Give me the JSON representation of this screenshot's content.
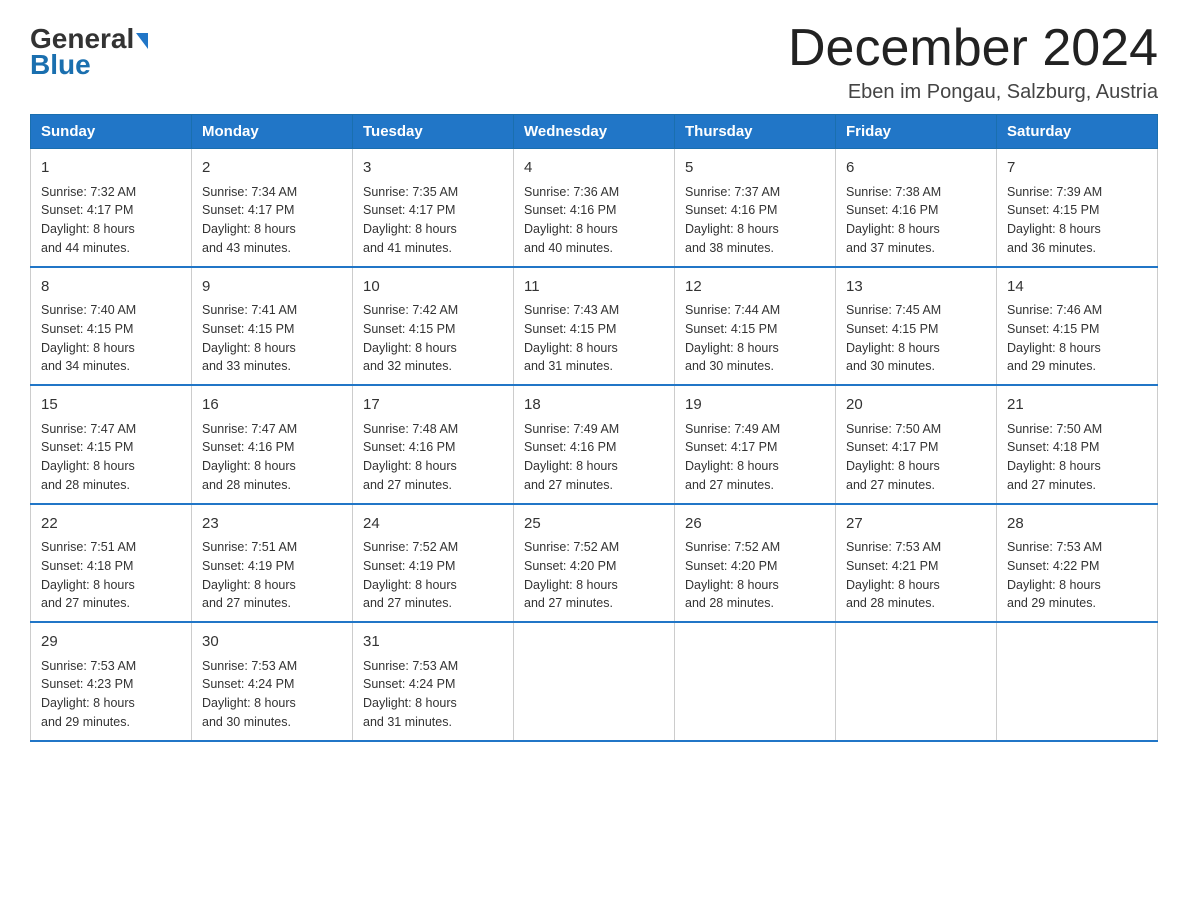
{
  "header": {
    "logo_general": "General",
    "logo_blue": "Blue",
    "month_title": "December 2024",
    "location": "Eben im Pongau, Salzburg, Austria"
  },
  "days_of_week": [
    "Sunday",
    "Monday",
    "Tuesday",
    "Wednesday",
    "Thursday",
    "Friday",
    "Saturday"
  ],
  "weeks": [
    [
      {
        "day": "1",
        "sunrise": "7:32 AM",
        "sunset": "4:17 PM",
        "daylight": "8 hours and 44 minutes."
      },
      {
        "day": "2",
        "sunrise": "7:34 AM",
        "sunset": "4:17 PM",
        "daylight": "8 hours and 43 minutes."
      },
      {
        "day": "3",
        "sunrise": "7:35 AM",
        "sunset": "4:17 PM",
        "daylight": "8 hours and 41 minutes."
      },
      {
        "day": "4",
        "sunrise": "7:36 AM",
        "sunset": "4:16 PM",
        "daylight": "8 hours and 40 minutes."
      },
      {
        "day": "5",
        "sunrise": "7:37 AM",
        "sunset": "4:16 PM",
        "daylight": "8 hours and 38 minutes."
      },
      {
        "day": "6",
        "sunrise": "7:38 AM",
        "sunset": "4:16 PM",
        "daylight": "8 hours and 37 minutes."
      },
      {
        "day": "7",
        "sunrise": "7:39 AM",
        "sunset": "4:15 PM",
        "daylight": "8 hours and 36 minutes."
      }
    ],
    [
      {
        "day": "8",
        "sunrise": "7:40 AM",
        "sunset": "4:15 PM",
        "daylight": "8 hours and 34 minutes."
      },
      {
        "day": "9",
        "sunrise": "7:41 AM",
        "sunset": "4:15 PM",
        "daylight": "8 hours and 33 minutes."
      },
      {
        "day": "10",
        "sunrise": "7:42 AM",
        "sunset": "4:15 PM",
        "daylight": "8 hours and 32 minutes."
      },
      {
        "day": "11",
        "sunrise": "7:43 AM",
        "sunset": "4:15 PM",
        "daylight": "8 hours and 31 minutes."
      },
      {
        "day": "12",
        "sunrise": "7:44 AM",
        "sunset": "4:15 PM",
        "daylight": "8 hours and 30 minutes."
      },
      {
        "day": "13",
        "sunrise": "7:45 AM",
        "sunset": "4:15 PM",
        "daylight": "8 hours and 30 minutes."
      },
      {
        "day": "14",
        "sunrise": "7:46 AM",
        "sunset": "4:15 PM",
        "daylight": "8 hours and 29 minutes."
      }
    ],
    [
      {
        "day": "15",
        "sunrise": "7:47 AM",
        "sunset": "4:15 PM",
        "daylight": "8 hours and 28 minutes."
      },
      {
        "day": "16",
        "sunrise": "7:47 AM",
        "sunset": "4:16 PM",
        "daylight": "8 hours and 28 minutes."
      },
      {
        "day": "17",
        "sunrise": "7:48 AM",
        "sunset": "4:16 PM",
        "daylight": "8 hours and 27 minutes."
      },
      {
        "day": "18",
        "sunrise": "7:49 AM",
        "sunset": "4:16 PM",
        "daylight": "8 hours and 27 minutes."
      },
      {
        "day": "19",
        "sunrise": "7:49 AM",
        "sunset": "4:17 PM",
        "daylight": "8 hours and 27 minutes."
      },
      {
        "day": "20",
        "sunrise": "7:50 AM",
        "sunset": "4:17 PM",
        "daylight": "8 hours and 27 minutes."
      },
      {
        "day": "21",
        "sunrise": "7:50 AM",
        "sunset": "4:18 PM",
        "daylight": "8 hours and 27 minutes."
      }
    ],
    [
      {
        "day": "22",
        "sunrise": "7:51 AM",
        "sunset": "4:18 PM",
        "daylight": "8 hours and 27 minutes."
      },
      {
        "day": "23",
        "sunrise": "7:51 AM",
        "sunset": "4:19 PM",
        "daylight": "8 hours and 27 minutes."
      },
      {
        "day": "24",
        "sunrise": "7:52 AM",
        "sunset": "4:19 PM",
        "daylight": "8 hours and 27 minutes."
      },
      {
        "day": "25",
        "sunrise": "7:52 AM",
        "sunset": "4:20 PM",
        "daylight": "8 hours and 27 minutes."
      },
      {
        "day": "26",
        "sunrise": "7:52 AM",
        "sunset": "4:20 PM",
        "daylight": "8 hours and 28 minutes."
      },
      {
        "day": "27",
        "sunrise": "7:53 AM",
        "sunset": "4:21 PM",
        "daylight": "8 hours and 28 minutes."
      },
      {
        "day": "28",
        "sunrise": "7:53 AM",
        "sunset": "4:22 PM",
        "daylight": "8 hours and 29 minutes."
      }
    ],
    [
      {
        "day": "29",
        "sunrise": "7:53 AM",
        "sunset": "4:23 PM",
        "daylight": "8 hours and 29 minutes."
      },
      {
        "day": "30",
        "sunrise": "7:53 AM",
        "sunset": "4:24 PM",
        "daylight": "8 hours and 30 minutes."
      },
      {
        "day": "31",
        "sunrise": "7:53 AM",
        "sunset": "4:24 PM",
        "daylight": "8 hours and 31 minutes."
      },
      null,
      null,
      null,
      null
    ]
  ],
  "labels": {
    "sunrise_prefix": "Sunrise: ",
    "sunset_prefix": "Sunset: ",
    "daylight_prefix": "Daylight: "
  }
}
